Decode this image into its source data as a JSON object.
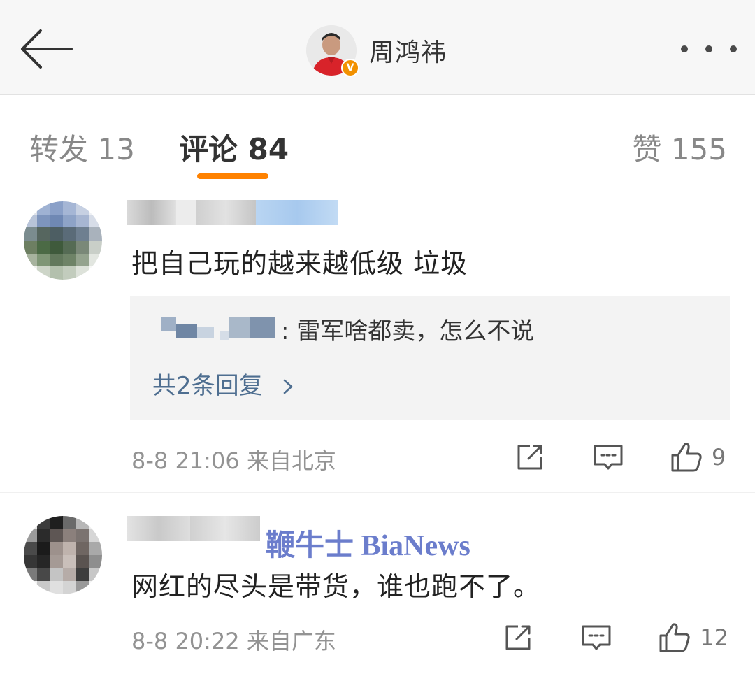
{
  "header": {
    "title": "周鸿祎",
    "verified_badge": "V",
    "back_icon": "arrow-left-icon",
    "more_icon": "more-dots-icon"
  },
  "tabs": [
    {
      "label": "转发 13",
      "active": false
    },
    {
      "label": "评论 84",
      "active": true
    },
    {
      "label": "赞 155",
      "active": false
    }
  ],
  "accent_color": "#ff8200",
  "link_color": "#4e6e90",
  "comments": [
    {
      "text": "把自己玩的越来越低级 垃圾",
      "reply": {
        "text": ": 雷军啥都卖，怎么不说",
        "more": "共2条回复"
      },
      "meta": "8-8 21:06 来自北京",
      "likes": "9"
    },
    {
      "text": "网红的尽头是带货，谁也跑不了。",
      "meta": "8-8 20:22 来自广东",
      "likes": "12"
    }
  ],
  "watermark": "鞭牛士 BiaNews"
}
